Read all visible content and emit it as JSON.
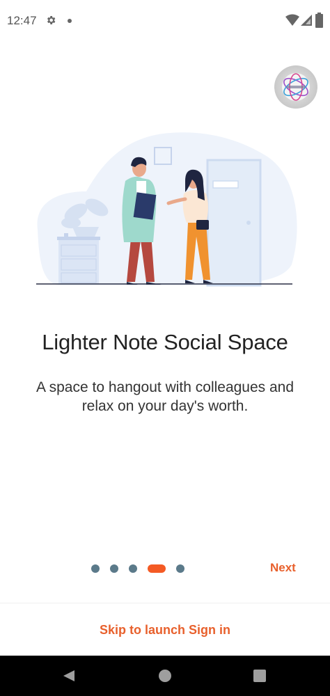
{
  "status_bar": {
    "time": "12:47",
    "icons": [
      "gear-icon",
      "dot-icon",
      "wifi-icon",
      "signal-icon",
      "battery-icon"
    ]
  },
  "onboarding": {
    "logo_icon": "app-logo",
    "illustration": "two-people-talking-illustration",
    "title": "Lighter Note Social Space",
    "subtitle": "A space to hangout with colleagues and relax on your day's worth.",
    "pager": {
      "total": 5,
      "active_index": 3
    },
    "next_label": "Next",
    "skip_label": "Skip to launch Sign in"
  },
  "colors": {
    "accent": "#e8602c",
    "dot_inactive": "#5b7a8a",
    "dot_active": "#f45a24"
  },
  "nav_bar": {
    "icons": [
      "back-icon",
      "home-icon",
      "recents-icon"
    ]
  }
}
